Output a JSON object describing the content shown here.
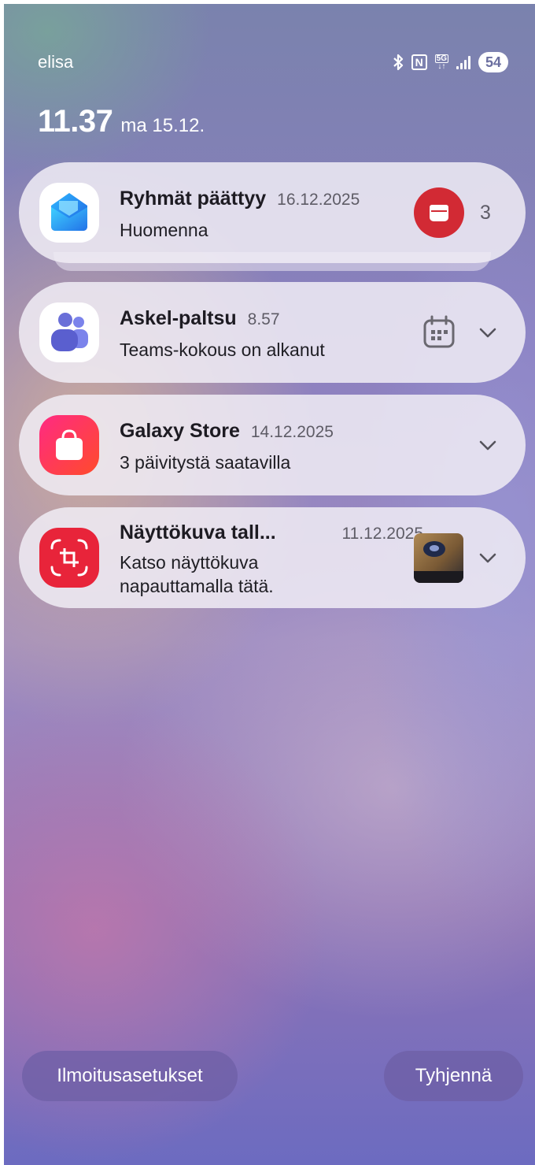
{
  "status_bar": {
    "carrier": "elisa",
    "network": "5G",
    "battery": "54"
  },
  "lockscreen": {
    "time": "11.37",
    "date": "ma 15.12."
  },
  "notifications": [
    {
      "app": "outlook-like",
      "title": "Ryhmät päättyy",
      "time": "16.12.2025",
      "body": "Huomenna",
      "count": "3",
      "accent": "#d22a34"
    },
    {
      "app": "teams",
      "title": "Askel-paltsu",
      "time": "8.57",
      "body": "Teams-kokous on alkanut"
    },
    {
      "app": "galaxy-store",
      "title": "Galaxy Store",
      "time": "14.12.2025",
      "body": "3 päivitystä saatavilla"
    },
    {
      "app": "screenshot",
      "title": "Näyttökuva tall...",
      "time": "11.12.2025",
      "body_line1": "Katso näyttökuva",
      "body_line2": "napauttamalla tätä."
    }
  ],
  "actions": {
    "settings_label": "Ilmoitusasetukset",
    "clear_label": "Tyhjennä"
  },
  "colors": {
    "teams": "#6a6fd8",
    "store": "#f02a5e",
    "screenshot": "#e8243a"
  }
}
